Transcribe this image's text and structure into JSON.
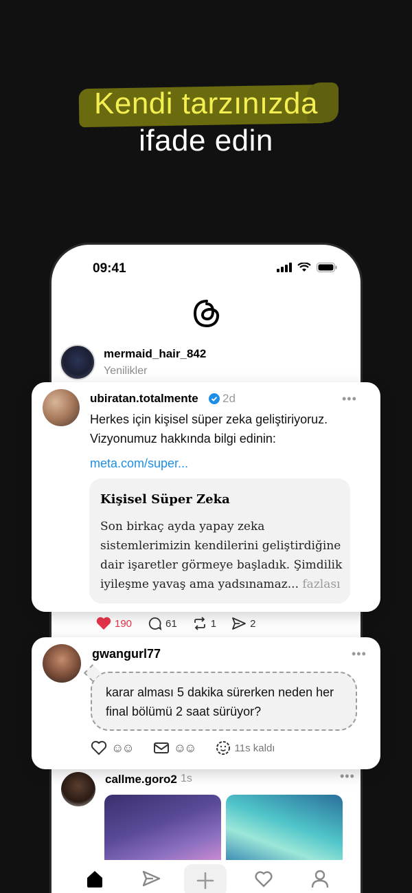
{
  "headline": {
    "line1": "Kendi tarzınızda",
    "line2": "ifade edin"
  },
  "status_bar": {
    "time": "09:41"
  },
  "app": {
    "logo": "threads-icon"
  },
  "feed_top": {
    "username": "mermaid_hair_842",
    "subtitle": "Yenilikler"
  },
  "post1": {
    "username": "ubiratan.totalmente",
    "time": "2d",
    "text": "Herkes için kişisel süper zeka geliştiriyoruz. Vizyonumuz hakkında bilgi edinin:",
    "link": "meta.com/super...",
    "preview": {
      "title": "Kişisel Süper Zeka",
      "body": "Son birkaç ayda yapay zeka sistemlerimizin kendilerini geliştirdiğine dair işaretler görmeye başladık. Şimdilik iyileşme yavaş ama yadsınamaz...",
      "more": "fazlası"
    },
    "stats": {
      "likes": "190",
      "replies": "61",
      "reposts": "1",
      "shares": "2"
    }
  },
  "post2": {
    "username": "gwangurl77",
    "text": "karar alması 5 dakika sürerken neden her final bölümü 2 saat sürüyor?",
    "timer": "11s kaldı"
  },
  "post3": {
    "username": "callme.goro2",
    "time": "1s"
  },
  "colors": {
    "accent_yellow": "#f3ee52",
    "like_red": "#e8344a",
    "link_blue": "#1d8ee6",
    "background": "#111111"
  },
  "tabbar": {
    "items": [
      "home-icon",
      "send-icon",
      "plus-icon",
      "heart-icon",
      "profile-icon"
    ]
  }
}
